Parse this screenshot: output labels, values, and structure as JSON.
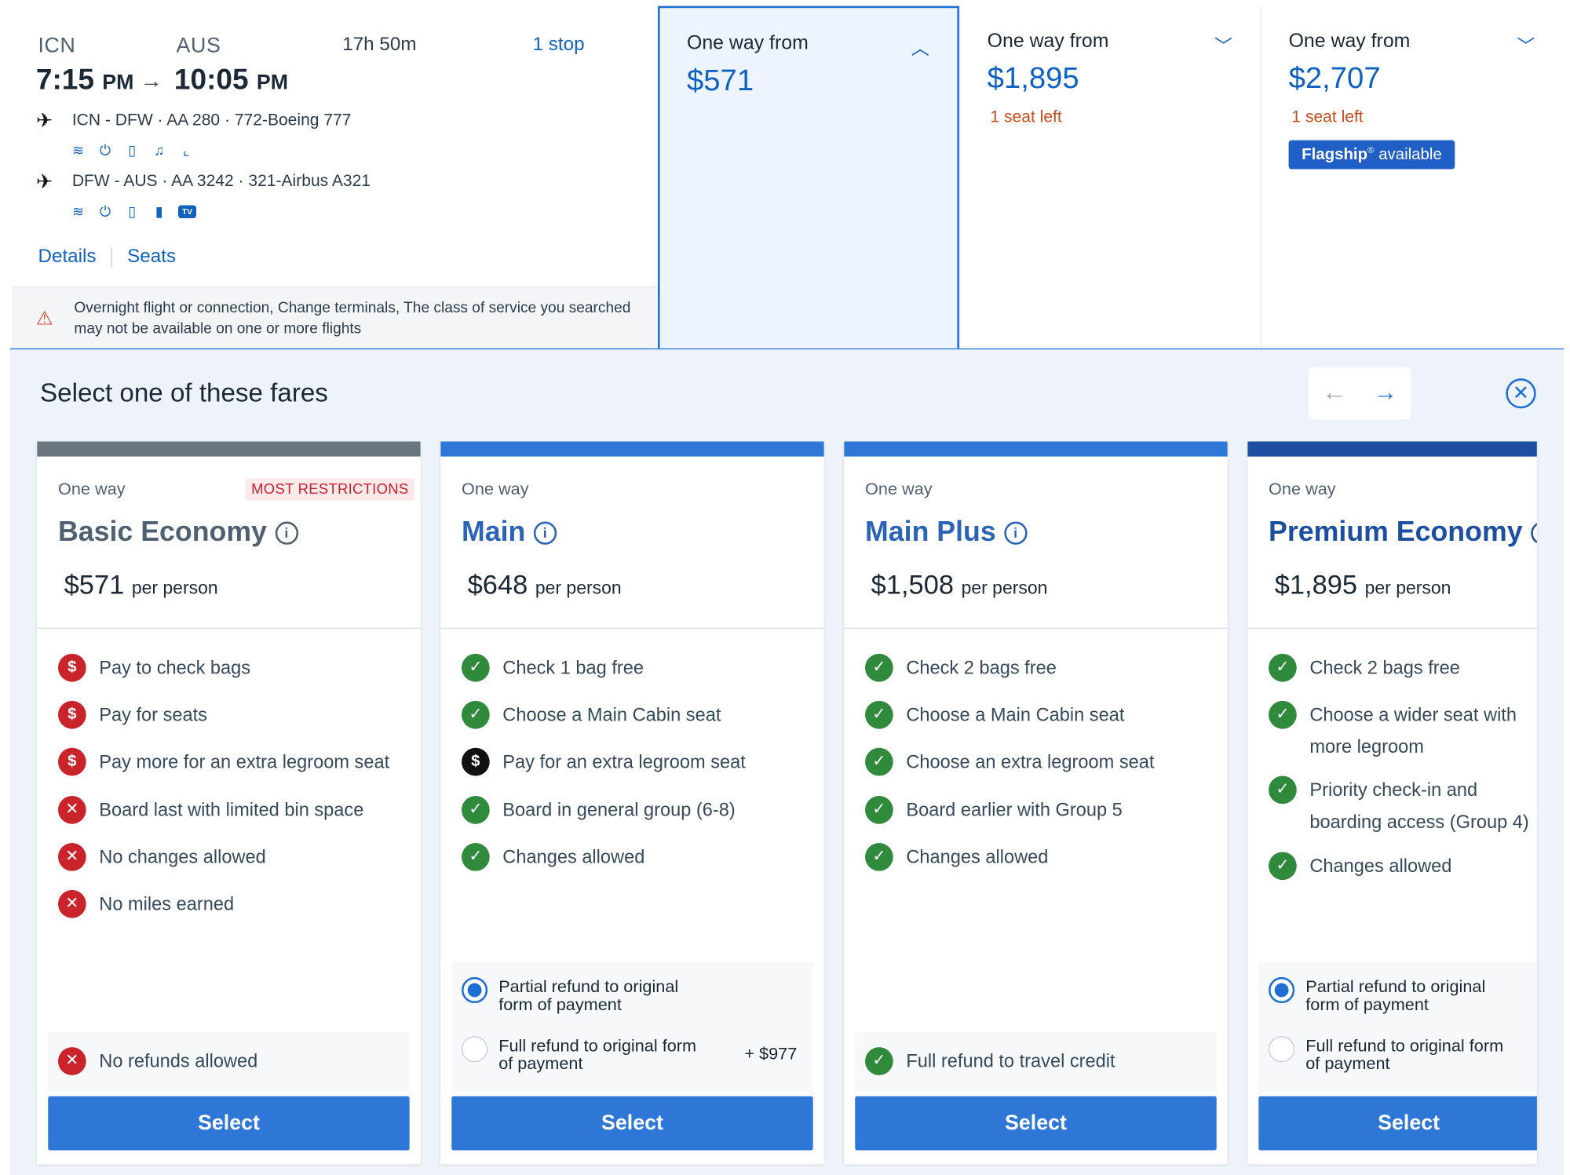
{
  "flight": {
    "origin": "ICN",
    "destination": "AUS",
    "depart_time": "7:15",
    "depart_ampm": "PM",
    "arrive_time": "10:05",
    "arrive_ampm": "PM",
    "duration": "17h 50m",
    "stops": "1 stop",
    "legs": [
      {
        "text": "ICN - DFW · AA 280 · 772-Boeing 777",
        "amenities": [
          "wifi-icon",
          "power-icon",
          "usb-icon",
          "entertainment-icon",
          "lie-flat-seat-icon"
        ]
      },
      {
        "text": "DFW - AUS · AA 3242 · 321-Airbus A321",
        "amenities": [
          "wifi-icon",
          "power-icon",
          "usb-icon",
          "device-icon",
          "tv-icon"
        ]
      }
    ],
    "tv_label": "TV",
    "details_link": "Details",
    "seats_link": "Seats",
    "warning": "Overnight flight or connection, Change terminals, The class of service you searched may not be available on one or more flights"
  },
  "cabins": [
    {
      "label": "One way from",
      "price": "$571",
      "seats_left": "",
      "selected": true
    },
    {
      "label": "One way from",
      "price": "$1,895",
      "seats_left": "1 seat left",
      "selected": false
    },
    {
      "label": "One way from",
      "price": "$2,707",
      "seats_left": "1 seat left",
      "flagship_brand": "Flagship",
      "flagship_mark": "®",
      "flagship_text": " available",
      "selected": false
    }
  ],
  "panel": {
    "title": "Select one of these fares",
    "prev_arrow": "←",
    "next_arrow": "→",
    "close_glyph": "✕"
  },
  "colors": {
    "accent": "#1f6ed4",
    "basic_bar": "#6b7580",
    "main_bar": "#2f77d6",
    "premium_bar": "#1d4fa0",
    "check_green": "#2f8a3c",
    "restriction_red": "#c9242b"
  },
  "fares": [
    {
      "one_way": "One way",
      "badge": "MOST RESTRICTIONS",
      "name": "Basic Economy",
      "price": "$571",
      "per": "per person",
      "features": [
        {
          "icon": "dollar",
          "text": "Pay to check bags"
        },
        {
          "icon": "dollar",
          "text": "Pay for seats"
        },
        {
          "icon": "dollar",
          "text": "Pay more for an extra legroom seat"
        },
        {
          "icon": "x",
          "text": "Board last with limited bin space"
        },
        {
          "icon": "x",
          "text": "No changes allowed"
        },
        {
          "icon": "x",
          "text": "No miles earned"
        }
      ],
      "refund_text": "No refunds allowed",
      "select": "Select"
    },
    {
      "one_way": "One way",
      "name": "Main",
      "price": "$648",
      "per": "per person",
      "features": [
        {
          "icon": "check",
          "text": "Check 1 bag free"
        },
        {
          "icon": "check",
          "text": "Choose a Main Cabin seat"
        },
        {
          "icon": "dollar-dark",
          "text": "Pay for an extra legroom seat"
        },
        {
          "icon": "check",
          "text": "Board in general group (6-8)"
        },
        {
          "icon": "check",
          "text": "Changes allowed"
        }
      ],
      "refund_options": [
        {
          "text": "Partial refund to original form of payment",
          "selected": true,
          "addon": ""
        },
        {
          "text": "Full refund to original form of payment",
          "selected": false,
          "addon": "+ $977"
        }
      ],
      "select": "Select"
    },
    {
      "one_way": "One way",
      "name": "Main Plus",
      "price": "$1,508",
      "per": "per person",
      "features": [
        {
          "icon": "check",
          "text": "Check 2 bags free"
        },
        {
          "icon": "check",
          "text": "Choose a Main Cabin seat"
        },
        {
          "icon": "check",
          "text": "Choose an extra legroom seat"
        },
        {
          "icon": "check",
          "text": "Board earlier with Group 5"
        },
        {
          "icon": "check",
          "text": "Changes allowed"
        }
      ],
      "refund_text": "Full refund to travel credit",
      "select": "Select"
    },
    {
      "one_way": "One way",
      "name": "Premium Economy",
      "price": "$1,895",
      "per": "per person",
      "features": [
        {
          "icon": "check",
          "text": "Check 2 bags free"
        },
        {
          "icon": "check",
          "text": "Choose a wider seat with more legroom"
        },
        {
          "icon": "check",
          "text": "Priority check-in and boarding access (Group 4)"
        },
        {
          "icon": "check",
          "text": "Changes allowed"
        }
      ],
      "refund_options": [
        {
          "text": "Partial refund to original form of payment",
          "selected": true,
          "addon": ""
        },
        {
          "text": "Full refund to original form of payment",
          "selected": false,
          "addon": ""
        }
      ],
      "select": "Select"
    }
  ]
}
